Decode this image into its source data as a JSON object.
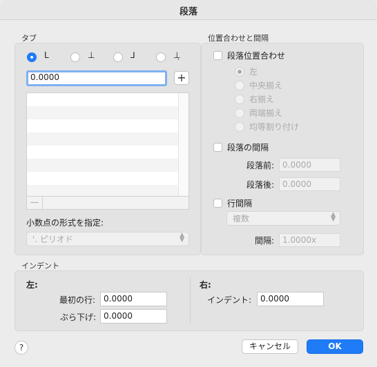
{
  "window": {
    "title": "段落"
  },
  "tabs_group": {
    "title": "タブ",
    "stops": [
      {
        "glyph": "L",
        "selected": true
      },
      {
        "glyph": "⊥",
        "selected": false
      },
      {
        "glyph": "⅃",
        "selected": false
      },
      {
        "glyph": "⊥̣",
        "selected": false
      }
    ],
    "position_value": "0.0000",
    "add_label": "+",
    "remove_label": "—",
    "decimal_label": "小数点の形式を指定:",
    "decimal_value": "'. ピリオド"
  },
  "alignment_group": {
    "title": "位置合わせと間隔",
    "align_checkbox": "段落位置合わせ",
    "align_options": [
      "左",
      "中央揃え",
      "右揃え",
      "両端揃え",
      "均等割り付け"
    ],
    "align_selected": 0,
    "spacing_checkbox": "段落の間隔",
    "before_label": "段落前:",
    "before_value": "0.0000",
    "after_label": "段落後:",
    "after_value": "0.0000",
    "line_checkbox": "行間隔",
    "line_mode": "複数",
    "line_label": "間隔:",
    "line_value": "1.0000x"
  },
  "indent_group": {
    "title": "インデント",
    "left_heading": "左:",
    "first_line_label": "最初の行:",
    "first_line_value": "0.0000",
    "hanging_label": "ぶら下げ:",
    "hanging_value": "0.0000",
    "right_heading": "右:",
    "right_indent_label": "インデント:",
    "right_indent_value": "0.0000"
  },
  "footer": {
    "help_label": "?",
    "cancel_label": "キャンセル",
    "ok_label": "OK"
  },
  "colors": {
    "accent": "#1f7bf6",
    "focus_ring": "#7fb0f2"
  }
}
